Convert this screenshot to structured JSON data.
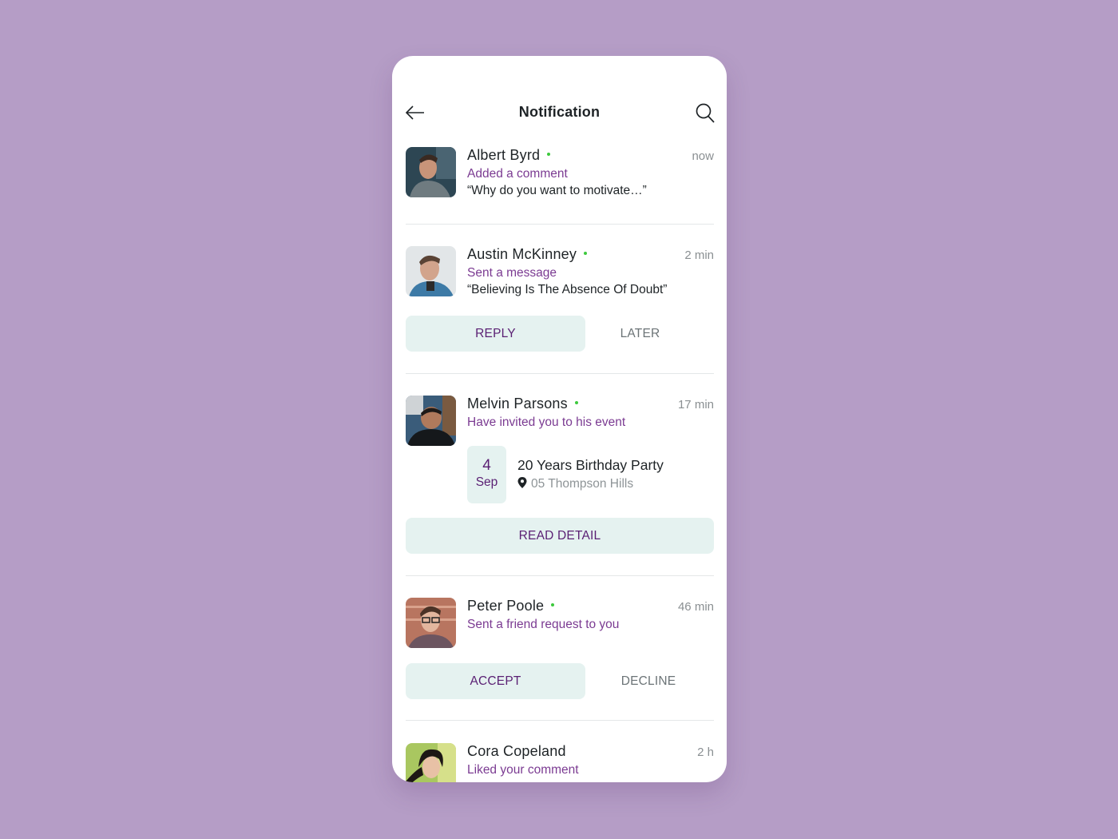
{
  "header": {
    "title": "Notification",
    "back_icon": "arrow-left-icon",
    "search_icon": "search-icon"
  },
  "notifications": [
    {
      "name": "Albert Byrd",
      "online": true,
      "time": "now",
      "action": "Added a comment",
      "quote": "“Why do you want to motivate…”"
    },
    {
      "name": "Austin McKinney",
      "online": true,
      "time": "2 min",
      "action": "Sent a message",
      "quote": "“Believing Is The Absence Of Doubt”",
      "primary_button": "REPLY",
      "secondary_button": "LATER"
    },
    {
      "name": "Melvin Parsons",
      "online": true,
      "time": "17 min",
      "action": "Have invited you to his event",
      "event": {
        "day": "4",
        "month": "Sep",
        "title": "20 Years Birthday Party",
        "location": "05 Thompson Hills",
        "location_icon": "map-pin-icon"
      },
      "primary_button": "READ DETAIL"
    },
    {
      "name": "Peter Poole",
      "online": true,
      "time": "46 min",
      "action": "Sent a friend request to you",
      "primary_button": "ACCEPT",
      "secondary_button": "DECLINE"
    },
    {
      "name": "Cora Copeland",
      "online": false,
      "time": "2 h",
      "action": "Liked your comment"
    }
  ],
  "colors": {
    "background": "#b59dc6",
    "accent_purple": "#7b3b92",
    "button_text": "#5a1f73",
    "button_bg": "#e5f2f0",
    "online_dot": "#3dc93d"
  }
}
